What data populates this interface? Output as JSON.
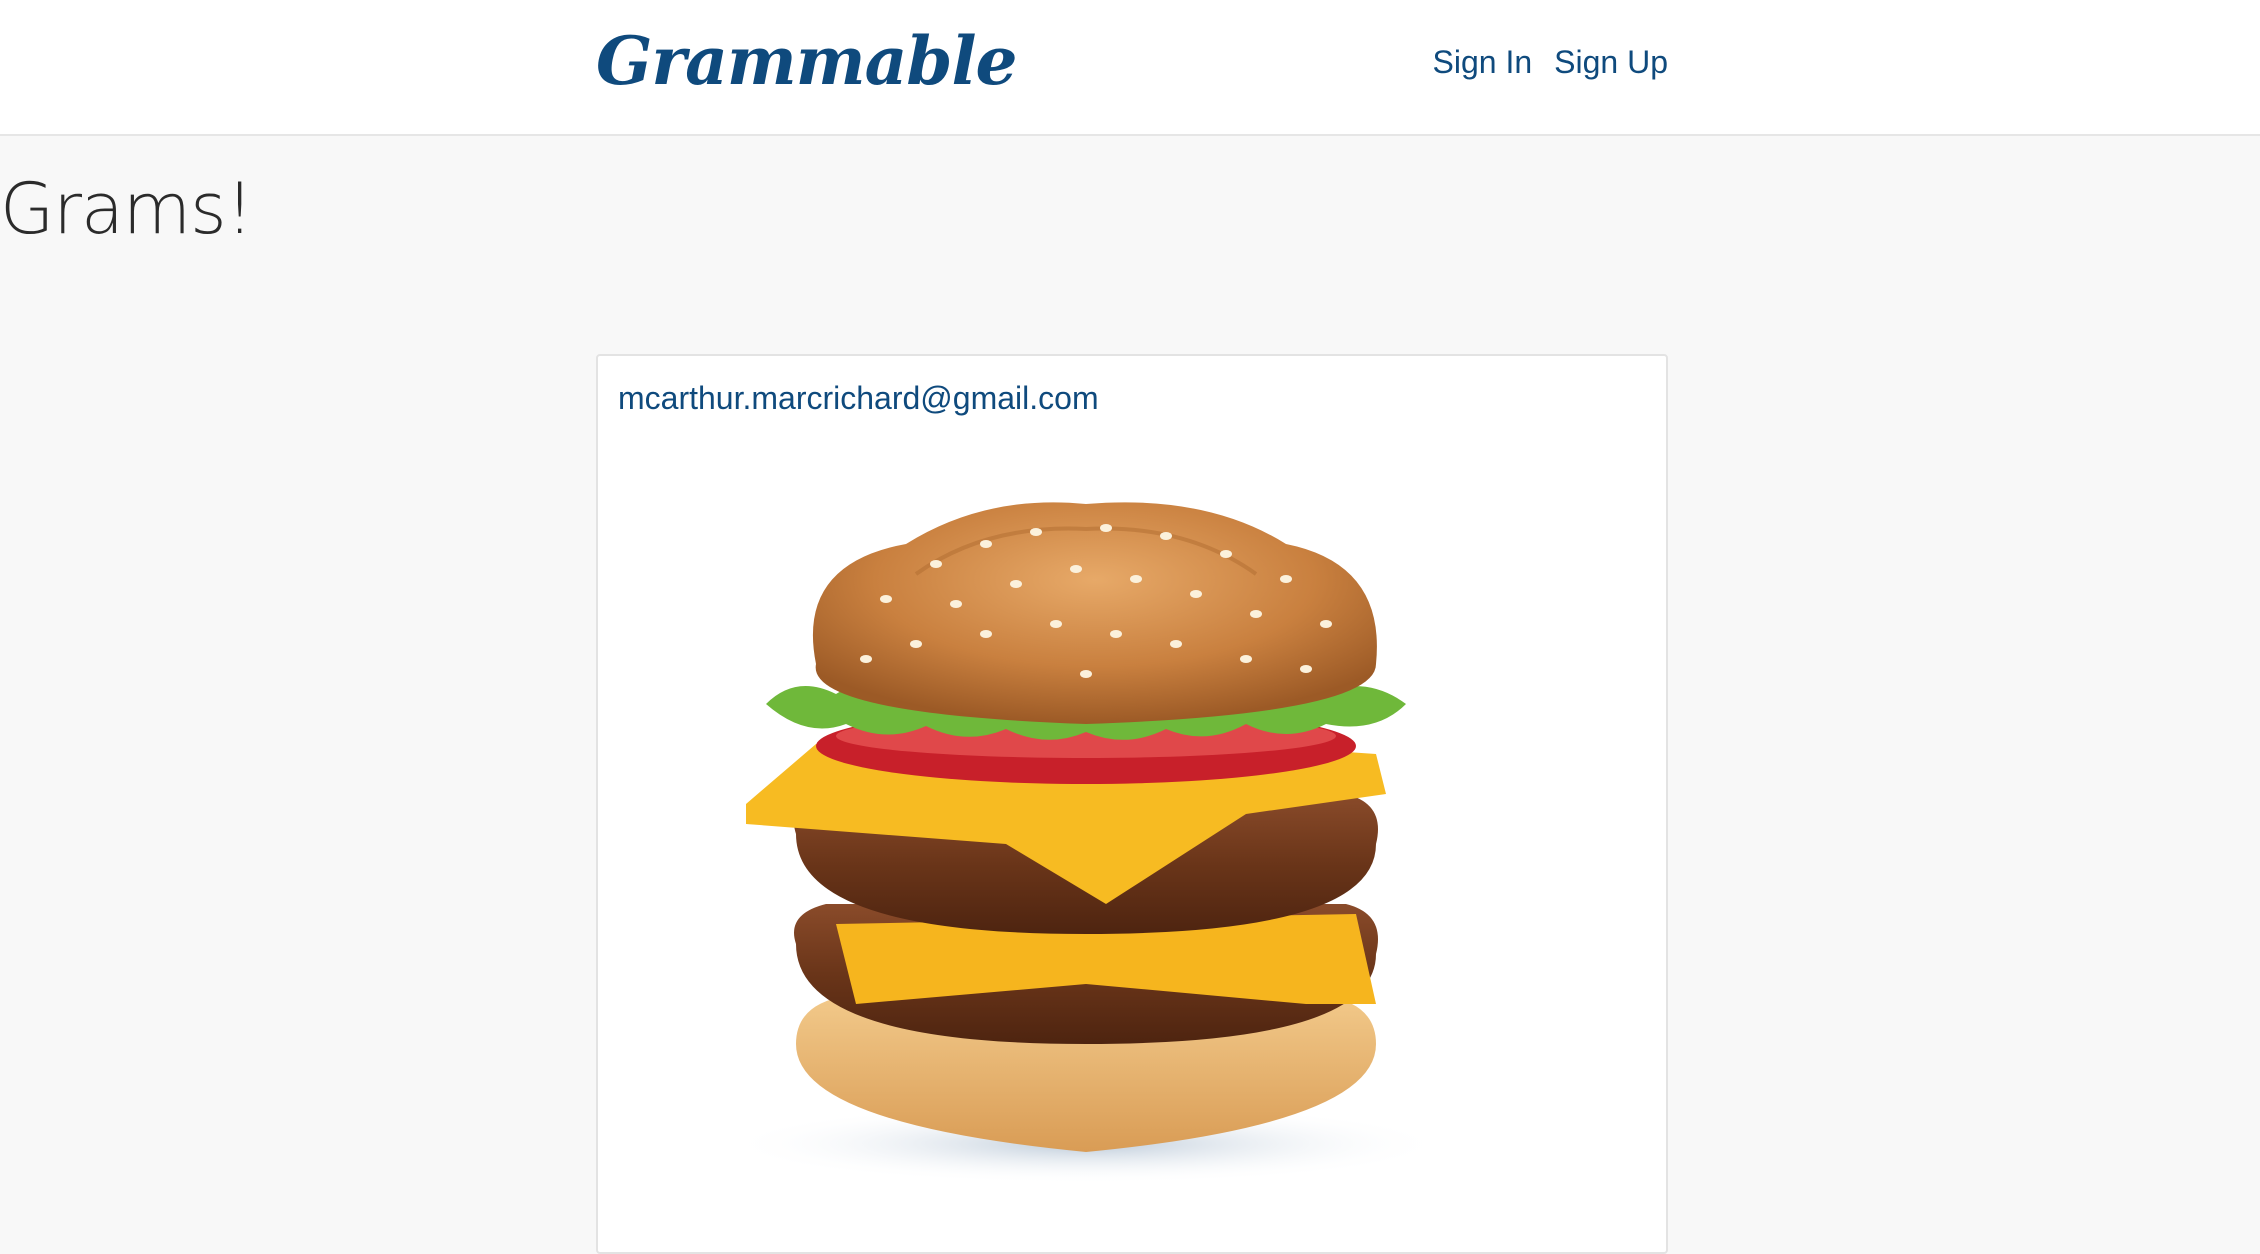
{
  "navbar": {
    "brand": "Grammable",
    "links": [
      {
        "label": "Sign In"
      },
      {
        "label": "Sign Up"
      }
    ]
  },
  "page": {
    "title": "Grams!"
  },
  "grams": [
    {
      "author": "mcarthur.marcrichard@gmail.com",
      "image_icon": "burger-photo"
    }
  ],
  "colors": {
    "brand": "#0f4a7d",
    "background": "#f8f8f8",
    "card": "#ffffff"
  }
}
